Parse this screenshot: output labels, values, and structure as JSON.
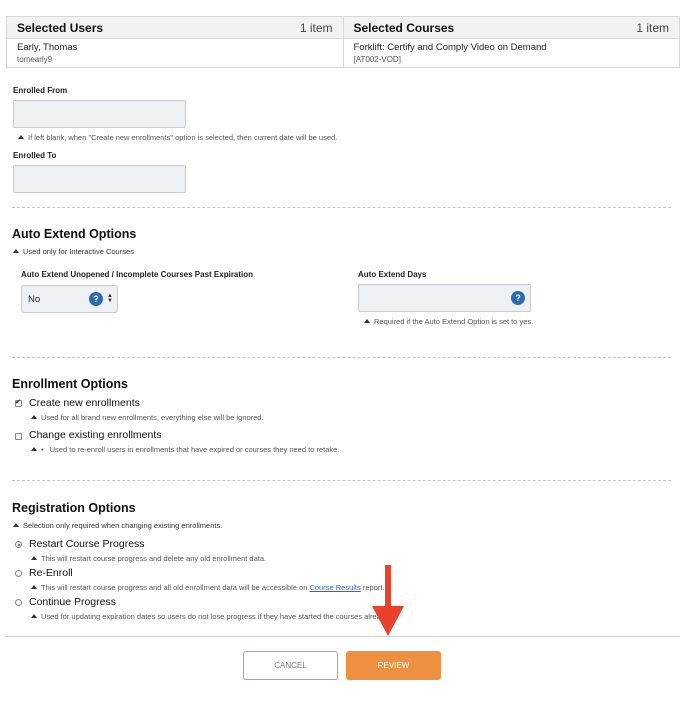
{
  "selected_users": {
    "title": "Selected Users",
    "count": "1 item",
    "name": "Early, Thomas",
    "sub": "tomearly9"
  },
  "selected_courses": {
    "title": "Selected Courses",
    "count": "1 item",
    "name": "Forklift: Certify and Comply Video on Demand",
    "sub": "[AT002-VOD]"
  },
  "enrolled_from": {
    "label": "Enrolled From",
    "value": "",
    "note": "If left blank, when \"Create new enrollments\" option is selected, then current date will be used."
  },
  "enrolled_to": {
    "label": "Enrolled To",
    "value": ""
  },
  "auto_extend": {
    "heading": "Auto Extend Options",
    "note": "Used only for Interactive Courses",
    "unopened_label": "Auto Extend Unopened / Incomplete Courses Past Expiration",
    "unopened_value": "No",
    "days_label": "Auto Extend Days",
    "days_value": "",
    "days_note": "Required if the Auto Extend Option is set to yes.",
    "help_glyph": "?"
  },
  "enrollment_options": {
    "heading": "Enrollment Options",
    "create_label": "Create new enrollments",
    "create_checked": true,
    "create_note": "Used for all brand new enrollments, everything else will be ignored.",
    "change_label": "Change existing enrollments",
    "change_checked": false,
    "change_note": "Used to re-enroll users in enrollments that have expired or courses they need to retake.",
    "change_bullet": "•"
  },
  "registration_options": {
    "heading": "Registration Options",
    "note": "Selection only required when changing existing enrollments.",
    "restart_label": "Restart Course Progress",
    "restart_note": "This will restart course progress and delete any old enrollment data.",
    "reenroll_label": "Re-Enroll",
    "reenroll_note_before": "This will restart course progress and all old enrollment data will be accessible on",
    "reenroll_link": "Course Results",
    "reenroll_note_after": "report.",
    "continue_label": "Continue Progress",
    "continue_note": "Used for updating expiration dates so users do not lose progress if they have started the courses already.",
    "selected": "restart"
  },
  "actions": {
    "cancel": "CANCEL",
    "review": "REVIEW"
  },
  "colors": {
    "accent": "#ef9040",
    "arrow": "#e8412c",
    "help": "#2b6cb0"
  }
}
